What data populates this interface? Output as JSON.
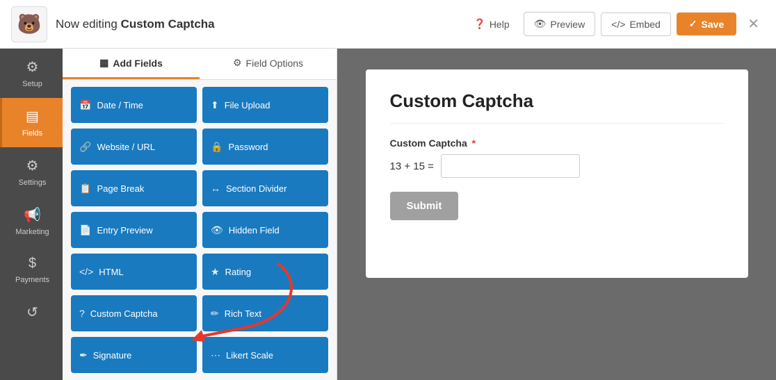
{
  "header": {
    "logo": "🐻",
    "editing_label": "Now editing",
    "form_name": "Custom Captcha",
    "help_label": "Help",
    "preview_label": "Preview",
    "embed_label": "Embed",
    "save_label": "Save",
    "close_icon": "✕"
  },
  "sidebar": {
    "items": [
      {
        "id": "setup",
        "label": "Setup",
        "icon": "⚙"
      },
      {
        "id": "fields",
        "label": "Fields",
        "icon": "▤"
      },
      {
        "id": "settings",
        "label": "Settings",
        "icon": "⚙"
      },
      {
        "id": "marketing",
        "label": "Marketing",
        "icon": "📢"
      },
      {
        "id": "payments",
        "label": "Payments",
        "icon": "$"
      },
      {
        "id": "history",
        "label": "",
        "icon": "↺"
      }
    ]
  },
  "fields_panel": {
    "tabs": [
      {
        "id": "add-fields",
        "label": "Add Fields",
        "icon": "▦"
      },
      {
        "id": "field-options",
        "label": "Field Options",
        "icon": "⚙"
      }
    ],
    "buttons": [
      {
        "id": "date-time",
        "label": "Date / Time",
        "icon": "📅",
        "col": 0
      },
      {
        "id": "file-upload",
        "label": "File Upload",
        "icon": "⬆",
        "col": 1
      },
      {
        "id": "website-url",
        "label": "Website / URL",
        "icon": "🔗",
        "col": 0
      },
      {
        "id": "password",
        "label": "Password",
        "icon": "🔒",
        "col": 1
      },
      {
        "id": "page-break",
        "label": "Page Break",
        "icon": "📋",
        "col": 0
      },
      {
        "id": "section-divider",
        "label": "Section Divider",
        "icon": "↔",
        "col": 1
      },
      {
        "id": "entry-preview",
        "label": "Entry Preview",
        "icon": "📄",
        "col": 0
      },
      {
        "id": "hidden-field",
        "label": "Hidden Field",
        "icon": "👁",
        "col": 1
      },
      {
        "id": "html",
        "label": "HTML",
        "icon": "</>",
        "col": 0
      },
      {
        "id": "rating",
        "label": "Rating",
        "icon": "★",
        "col": 1
      },
      {
        "id": "custom-captcha",
        "label": "Custom Captcha",
        "icon": "?",
        "col": 0
      },
      {
        "id": "rich-text",
        "label": "Rich Text",
        "icon": "✏",
        "col": 1
      },
      {
        "id": "signature",
        "label": "Signature",
        "icon": "✒",
        "col": 0
      },
      {
        "id": "likert-scale",
        "label": "Likert Scale",
        "icon": "⋯",
        "col": 1
      }
    ]
  },
  "form_preview": {
    "title": "Custom Captcha",
    "fields": [
      {
        "label": "Custom Captcha",
        "required": true,
        "type": "captcha",
        "equation": "13 + 15 ="
      }
    ],
    "submit_label": "Submit"
  }
}
